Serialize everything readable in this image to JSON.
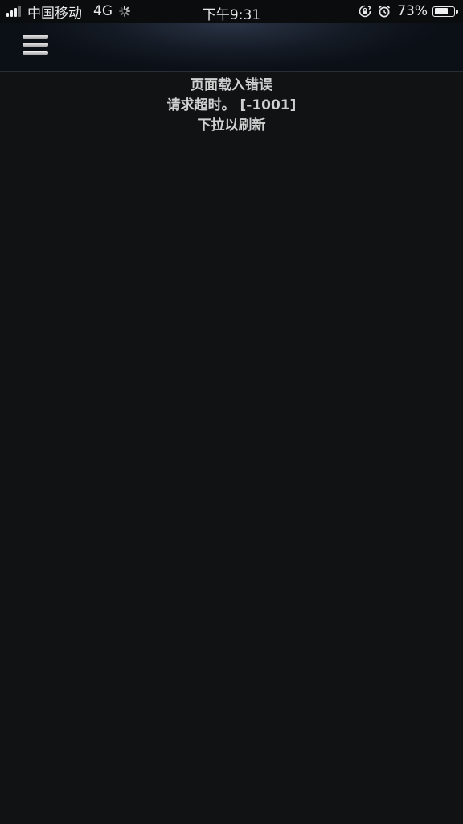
{
  "status_bar": {
    "carrier": "中国移动",
    "network": "4G",
    "time": "下午9:31",
    "battery_percent": "73%",
    "battery_level": 0.73,
    "icons": [
      "signal-icon",
      "loading-spinner-icon",
      "orientation-lock-icon",
      "alarm-icon",
      "battery-icon"
    ]
  },
  "nav": {
    "menu_icon": "hamburger-menu-icon"
  },
  "error": {
    "title": "页面载入错误",
    "detail": "请求超时。 [-1001]",
    "hint": "下拉以刷新"
  },
  "colors": {
    "background": "#111214",
    "nav_background": "#0b0f16",
    "text": "#d0d0d0"
  }
}
